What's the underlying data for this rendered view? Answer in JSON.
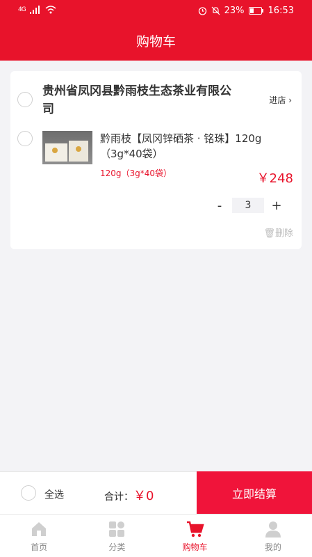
{
  "status": {
    "network": "4G",
    "battery": "23%",
    "time": "16:53"
  },
  "header": {
    "title": "购物车"
  },
  "shop": {
    "name": "贵州省凤冈县黔雨枝生态茶业有限公司",
    "enter_label": "进店"
  },
  "item": {
    "name": "黔雨枝【凤冈锌硒茶 · 铭珠】120g（3g*40袋）",
    "spec": "120g（3g*40袋）",
    "price": "￥248",
    "qty_minus": "-",
    "quantity": "3",
    "qty_plus": "+",
    "delete_label": "删除"
  },
  "footer": {
    "select_all": "全选",
    "total_label": "合计：",
    "total_value": "￥0",
    "checkout": "立即结算"
  },
  "tabs": [
    {
      "label": "首页",
      "icon": "home-icon"
    },
    {
      "label": "分类",
      "icon": "category-icon"
    },
    {
      "label": "购物车",
      "icon": "cart-icon"
    },
    {
      "label": "我的",
      "icon": "user-icon"
    }
  ],
  "colors": {
    "accent": "#e8132b",
    "checkout": "#f0143a"
  }
}
